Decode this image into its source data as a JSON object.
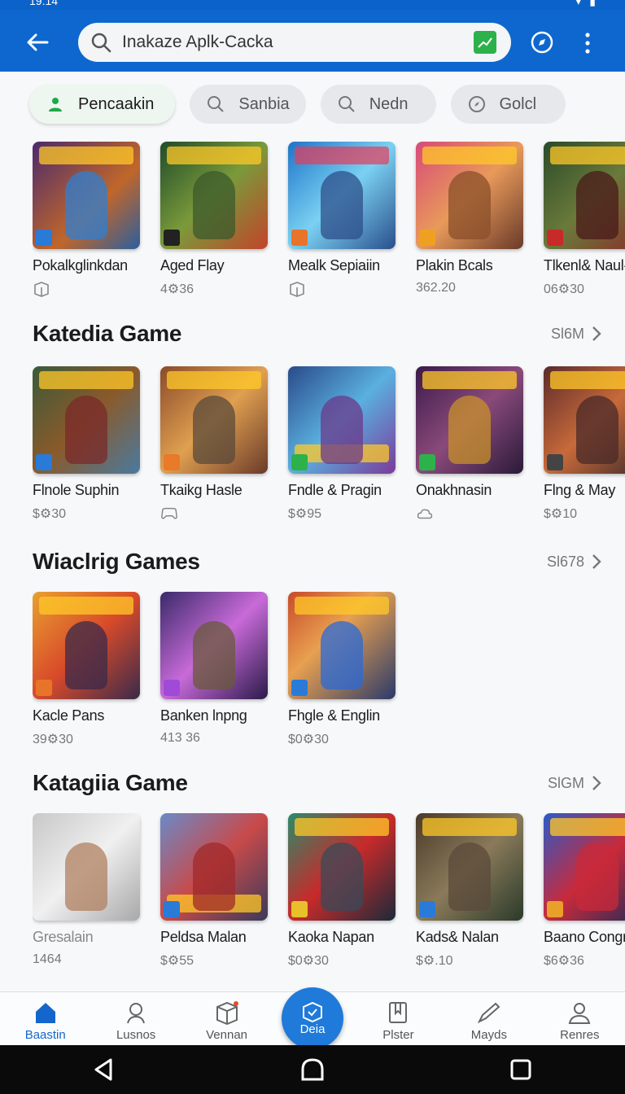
{
  "status": {
    "time": "19:14"
  },
  "search": {
    "value": "Inakaze Aplk-Cacka"
  },
  "chips": [
    {
      "label": "Pencaakin",
      "icon": "person-icon"
    },
    {
      "label": "Sanbia",
      "icon": "search-icon"
    },
    {
      "label": "Nedn",
      "icon": "search-icon"
    },
    {
      "label": "Golcl",
      "icon": "compass-icon"
    }
  ],
  "top_row": [
    {
      "name": "Pokalkglinkdan",
      "meta": ""
    },
    {
      "name": "Aged Flay",
      "meta": "4⚙36"
    },
    {
      "name": "Mealk Sepiaiin",
      "meta": ""
    },
    {
      "name": "Plakin Bcals",
      "meta": "362.20"
    },
    {
      "name": "Tlkenl& Naul-",
      "meta": "06⚙30"
    }
  ],
  "sections": [
    {
      "title": "Katedia Game",
      "more": "Sl6M",
      "items": [
        {
          "name": "Flnole Suphin",
          "meta": "$⚙30"
        },
        {
          "name": "Tkaikg Hasle",
          "meta": ""
        },
        {
          "name": "Fndle & Pragin",
          "meta": "$⚙95"
        },
        {
          "name": "Onakhnasin",
          "meta": ""
        },
        {
          "name": "Flng & May",
          "meta": "$⚙10"
        }
      ]
    },
    {
      "title": "Wiaclrig Games",
      "more": "Sl678",
      "items": [
        {
          "name": "Kacle Pans",
          "meta": "39⚙30"
        },
        {
          "name": "Banken lnpng",
          "meta": "413 36"
        },
        {
          "name": "Fhgle & Englin",
          "meta": "$0⚙30"
        }
      ]
    },
    {
      "title": "Katagiia Game",
      "more": "SlGM",
      "items": [
        {
          "name": "Gresalain",
          "meta": "1464"
        },
        {
          "name": "Peldsa Malan",
          "meta": "$⚙55"
        },
        {
          "name": "Kaoka Napan",
          "meta": "$0⚙30"
        },
        {
          "name": "Kads& Nalan",
          "meta": "$⚙.10"
        },
        {
          "name": "Baano Congr",
          "meta": "$6⚙36"
        }
      ]
    }
  ],
  "bottom_nav": [
    {
      "label": "Baastin"
    },
    {
      "label": "Lusnos"
    },
    {
      "label": "Vennan"
    },
    {
      "label": "Deia"
    },
    {
      "label": "Plster"
    },
    {
      "label": "Mayds"
    },
    {
      "label": "Renres"
    }
  ],
  "colors": {
    "primary": "#0d67cf",
    "active_nav": "#1466cc",
    "fab": "#1f7ad9"
  }
}
